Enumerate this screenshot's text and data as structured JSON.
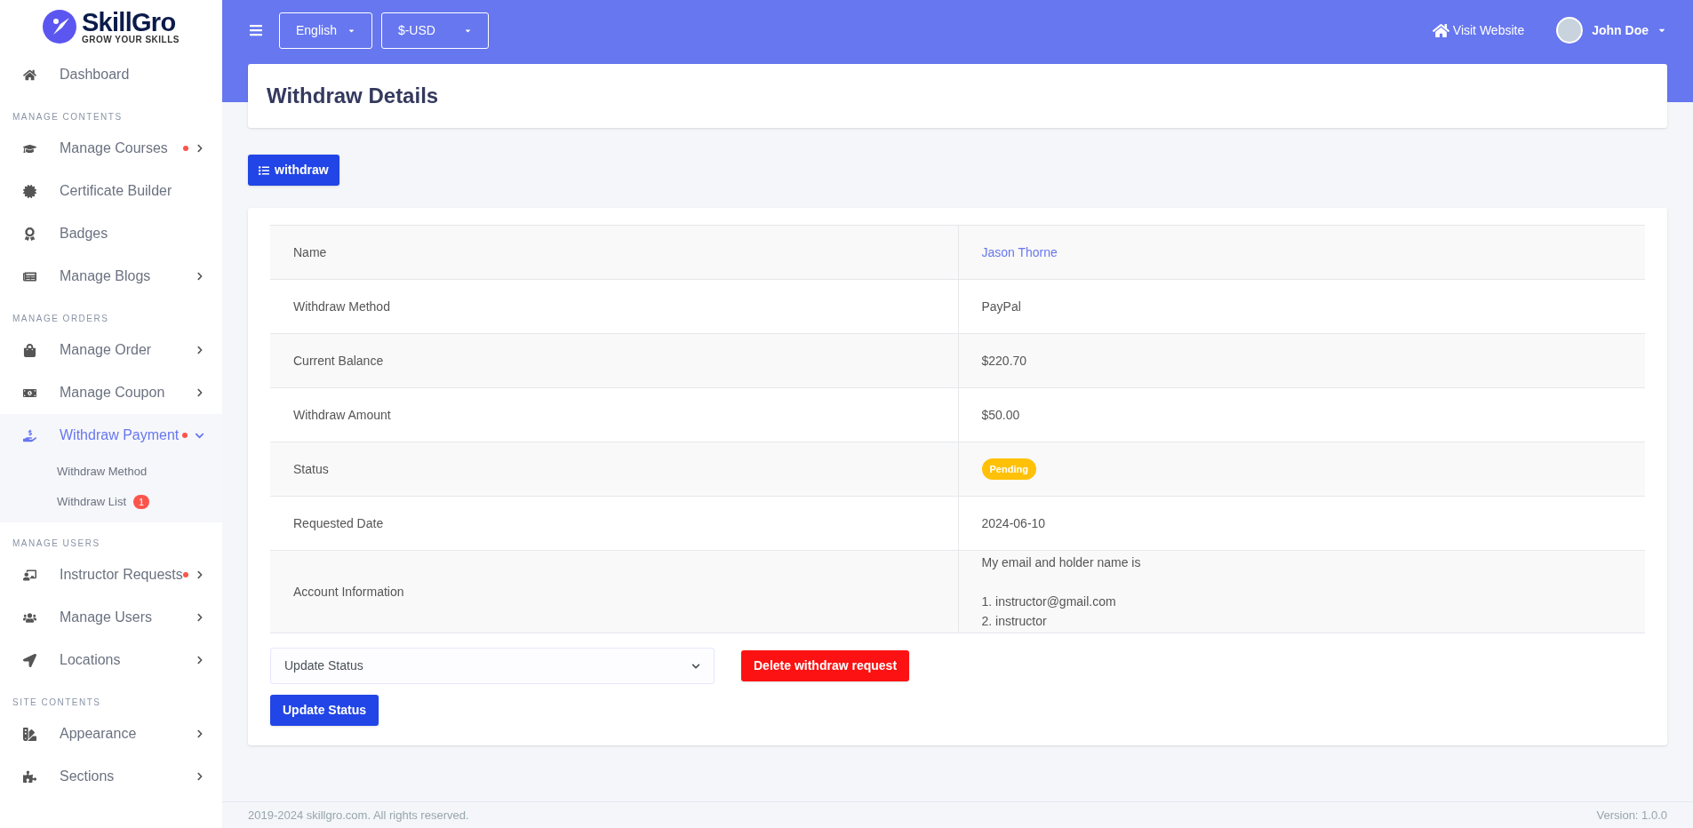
{
  "logo": {
    "name": "SkillGro",
    "tagline": "GROW YOUR SKILLS"
  },
  "sidebar": {
    "sections": [
      {
        "items": [
          {
            "label": "Dashboard",
            "dot": false,
            "expandable": false,
            "selected": false
          }
        ]
      },
      {
        "heading": "MANAGE CONTENTS",
        "items": [
          {
            "label": "Manage Courses",
            "dot": true,
            "expandable": true,
            "expanded": false,
            "selected": false
          },
          {
            "label": "Certificate Builder",
            "dot": false,
            "expandable": false,
            "selected": false
          },
          {
            "label": "Badges",
            "dot": false,
            "expandable": false,
            "selected": false
          },
          {
            "label": "Manage Blogs",
            "dot": false,
            "expandable": true,
            "expanded": false,
            "selected": false
          }
        ]
      },
      {
        "heading": "MANAGE ORDERS",
        "items": [
          {
            "label": "Manage Order",
            "dot": false,
            "expandable": true,
            "expanded": false,
            "selected": false
          },
          {
            "label": "Manage Coupon",
            "dot": false,
            "expandable": true,
            "expanded": false,
            "selected": false
          },
          {
            "label": "Withdraw Payment",
            "dot": true,
            "expandable": true,
            "expanded": true,
            "selected": true,
            "children": [
              {
                "label": "Withdraw Method"
              },
              {
                "label": "Withdraw List",
                "badge": "1"
              }
            ]
          }
        ]
      },
      {
        "heading": "MANAGE USERS",
        "items": [
          {
            "label": "Instructor Requests",
            "dot": true,
            "expandable": true,
            "expanded": false,
            "selected": false
          },
          {
            "label": "Manage Users",
            "dot": false,
            "expandable": true,
            "expanded": false,
            "selected": false
          },
          {
            "label": "Locations",
            "dot": false,
            "expandable": true,
            "expanded": false,
            "selected": false
          }
        ]
      },
      {
        "heading": "SITE CONTENTS",
        "items": [
          {
            "label": "Appearance",
            "dot": false,
            "expandable": true,
            "expanded": false,
            "selected": false
          },
          {
            "label": "Sections",
            "dot": false,
            "expandable": true,
            "expanded": false,
            "selected": false
          }
        ]
      }
    ]
  },
  "topbar": {
    "language": "English",
    "currency": "$-USD",
    "visit_link": "Visit Website",
    "user": "John Doe"
  },
  "page_title": "Withdraw Details",
  "back_button": "withdraw",
  "details": [
    {
      "label": "Name",
      "kind": "link",
      "value": "Jason Thorne"
    },
    {
      "label": "Withdraw Method",
      "kind": "text",
      "value": "PayPal"
    },
    {
      "label": "Current Balance",
      "kind": "text",
      "value": "$220.70"
    },
    {
      "label": "Withdraw Amount",
      "kind": "text",
      "value": "$50.00"
    },
    {
      "label": "Status",
      "kind": "badge",
      "value": "Pending"
    },
    {
      "label": "Requested Date",
      "kind": "text",
      "value": "2024-06-10"
    },
    {
      "label": "Account Information",
      "kind": "lines",
      "paragraphs": [
        [
          "My email and holder name is"
        ],
        [
          "1. instructor@gmail.com",
          "2. instructor"
        ]
      ]
    }
  ],
  "status_select": {
    "value": "Update Status"
  },
  "delete_button": "Delete withdraw request",
  "update_button": "Update Status",
  "footer": {
    "copyright": "2019-2024 skillgro.com. All rights reserved.",
    "version": "Version: 1.0.0"
  }
}
